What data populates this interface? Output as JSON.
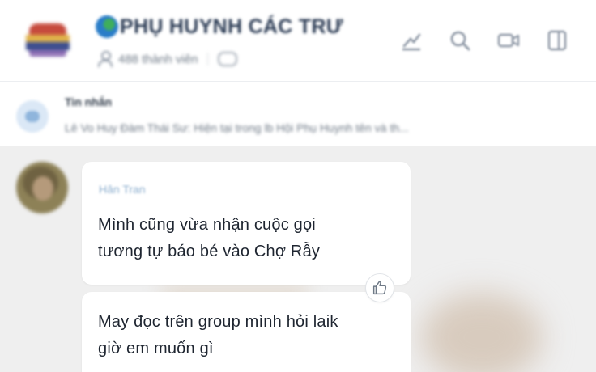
{
  "header": {
    "group_name": "PHỤ HUYNH CÁC TRƯ",
    "members": "488 thành viên",
    "colors": {
      "title": "#2b3b54",
      "muted": "#6f7a87"
    }
  },
  "pinned": {
    "label": "Tin nhắn",
    "preview": "Lê Vo Huy Đàm Thái Sư: Hiện tại trong lb Hội Phụ Huynh tên và th..."
  },
  "messages": [
    {
      "sender": "Hân Tran",
      "lines": [
        "Mình cũng vừa nhận cuộc gọi",
        "tương tự báo bé vào Chợ Rẫy"
      ]
    },
    {
      "lines": [
        "May đọc trên group mình hỏi laik",
        "giờ em muốn gì"
      ]
    }
  ],
  "icons": {
    "header": [
      "globe-icon",
      "member-icon",
      "tag-icon",
      "chart-icon",
      "search-icon",
      "video-call-icon",
      "sidebar-panel-icon"
    ],
    "pinned": "chat-bubble-icon",
    "reaction": "thumbs-up-icon"
  }
}
